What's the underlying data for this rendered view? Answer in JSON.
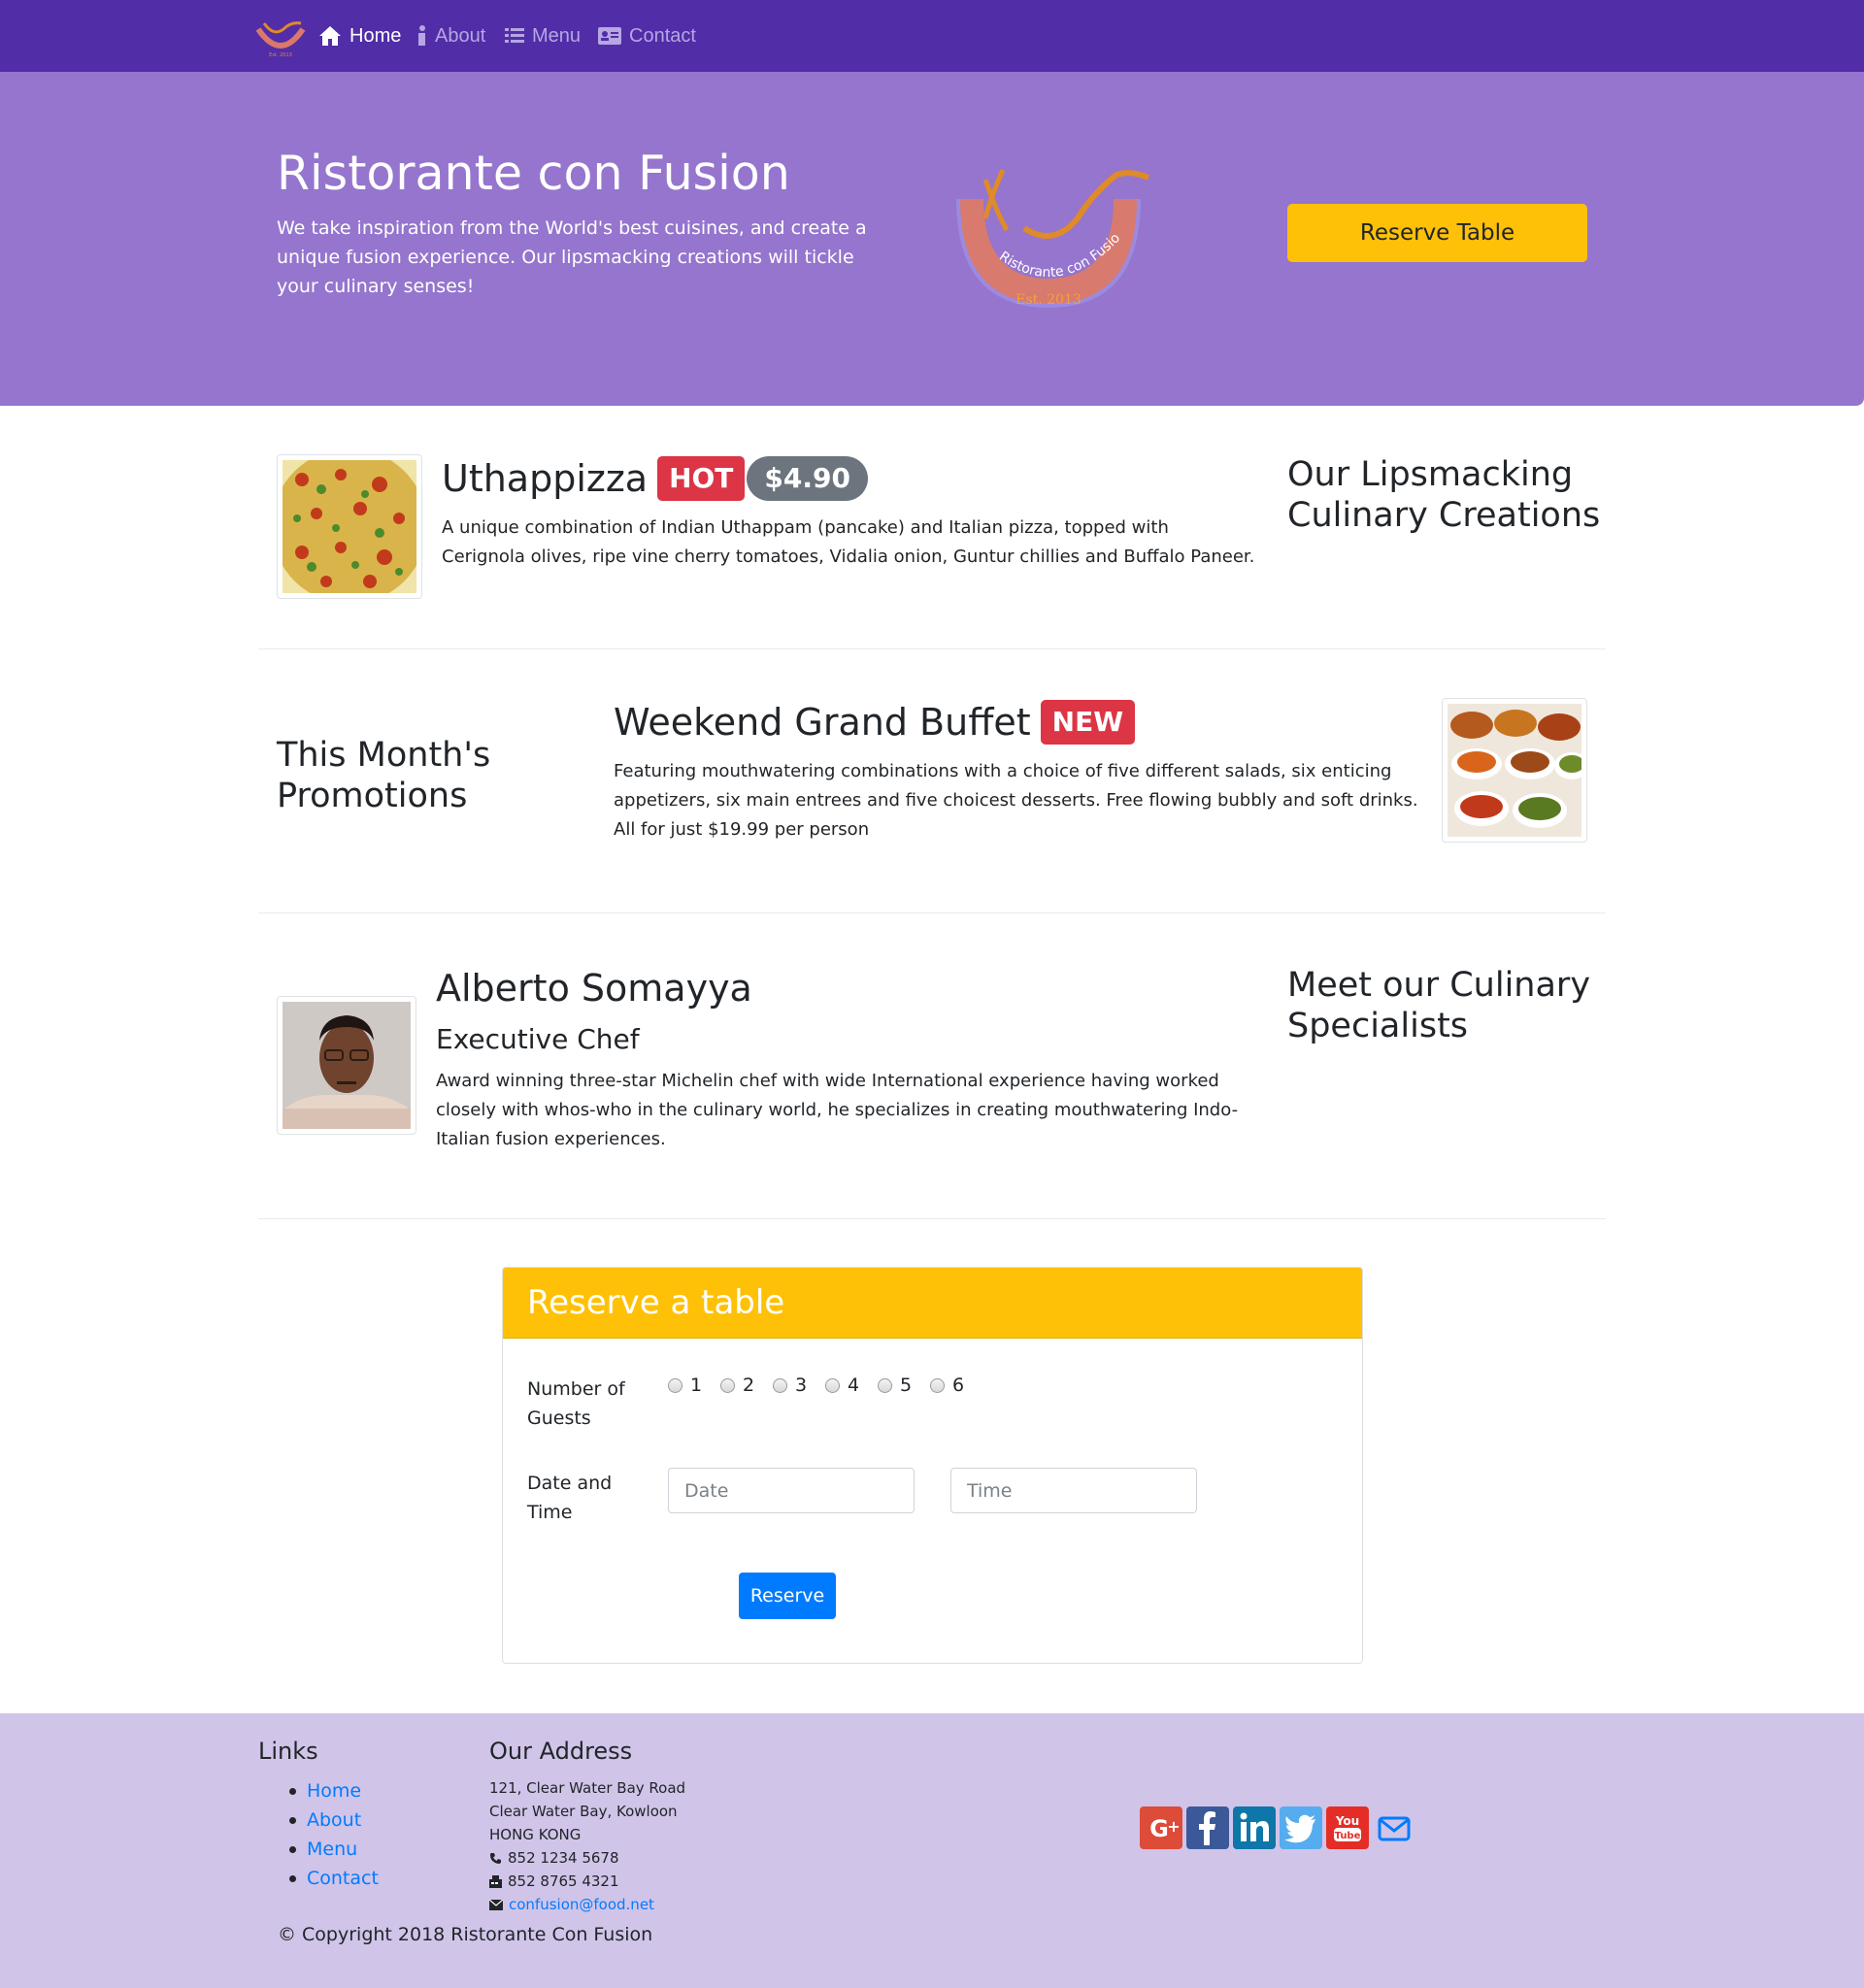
{
  "colors": {
    "navbar": "#512DA8",
    "jumbotron": "#9575CD",
    "footer": "#D1C4E9",
    "warning": "#FFC107",
    "danger": "#dc3545",
    "primary": "#007bff"
  },
  "nav": {
    "logo_icon": "restaurant-logo",
    "items": [
      {
        "label": "Home",
        "icon": "home-icon",
        "active": true
      },
      {
        "label": "About",
        "icon": "info-icon",
        "active": false
      },
      {
        "label": "Menu",
        "icon": "list-icon",
        "active": false
      },
      {
        "label": "Contact",
        "icon": "address-card-icon",
        "active": false
      }
    ]
  },
  "jumbotron": {
    "title": "Ristorante con Fusion",
    "text": "We take inspiration from the World's best cuisines, and create a unique fusion experience. Our lipsmacking creations will tickle your culinary senses!",
    "logo_text": "Ristorante con Fusion",
    "logo_est": "Est. 2013",
    "reserve_button": "Reserve Table"
  },
  "dish": {
    "name": "Uthappizza",
    "label_badge": "HOT",
    "price_badge": "$4.90",
    "description": "A unique combination of Indian Uthappam (pancake) and Italian pizza, topped with Cerignola olives, ripe vine cherry tomatoes, Vidalia onion, Guntur chillies and Buffalo Paneer.",
    "section_title": "Our Lipsmacking Culinary Creations"
  },
  "promotion": {
    "section_title": "This Month's Promotions",
    "name": "Weekend Grand Buffet",
    "label_badge": "NEW",
    "description": "Featuring mouthwatering combinations with a choice of five different salads, six enticing appetizers, six main entrees and five choicest desserts. Free flowing bubbly and soft drinks. All for just $19.99 per person"
  },
  "leader": {
    "name": "Alberto Somayya",
    "designation": "Executive Chef",
    "description": "Award winning three-star Michelin chef with wide International experience having worked closely with whos-who in the culinary world, he specializes in creating mouthwatering Indo-Italian fusion experiences.",
    "section_title": "Meet our Culinary Specialists"
  },
  "reservation": {
    "title": "Reserve a table",
    "guests_label": "Number of Guests",
    "guest_options": [
      "1",
      "2",
      "3",
      "4",
      "5",
      "6"
    ],
    "datetime_label": "Date and Time",
    "date_placeholder": "Date",
    "time_placeholder": "Time",
    "submit_label": "Reserve"
  },
  "footer": {
    "links_title": "Links",
    "links": [
      "Home",
      "About",
      "Menu",
      "Contact"
    ],
    "address_title": "Our Address",
    "address_lines": [
      "121, Clear Water Bay Road",
      "Clear Water Bay, Kowloon",
      "HONG KONG"
    ],
    "phone": "852 1234 5678",
    "fax": "852 8765 4321",
    "email": "confusion@food.net",
    "social_icons": [
      "google-plus-icon",
      "facebook-icon",
      "linkedin-icon",
      "twitter-icon",
      "youtube-icon",
      "mail-icon"
    ],
    "copyright": "© Copyright 2018 Ristorante Con Fusion"
  }
}
